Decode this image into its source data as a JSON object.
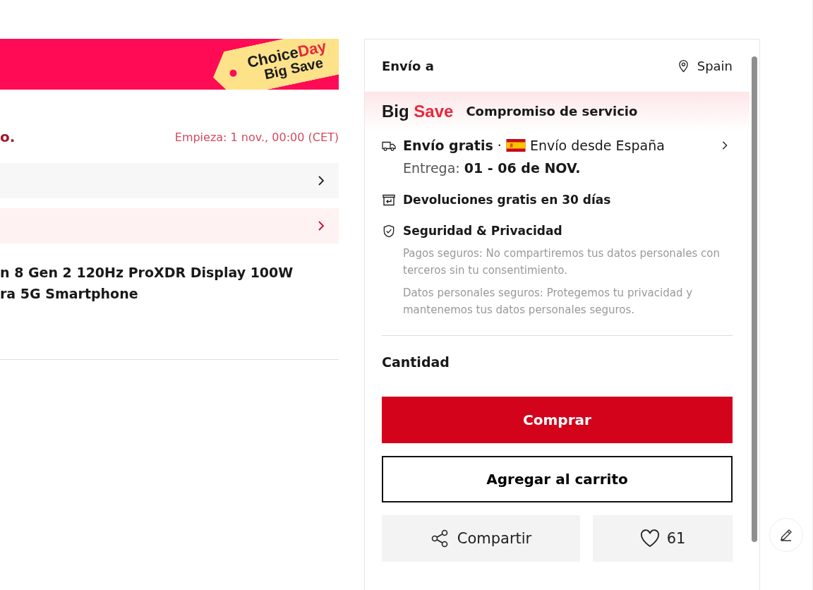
{
  "banner": {
    "tag": {
      "word1": "Choice",
      "word2": "Day",
      "line2": "Big Save"
    }
  },
  "promo": {
    "title_fragment": "o.",
    "start": "Empieza:  1 nov., 00:00 (CET)"
  },
  "option_rows": [
    {
      "kind": "plain"
    },
    {
      "kind": "highlight"
    }
  ],
  "product_title": [
    "n 8 Gen 2 120Hz ProXDR Display 100W",
    "ra 5G Smartphone"
  ],
  "panel": {
    "ship_to_label": "Envío a",
    "ship_to_country": "Spain",
    "service": {
      "brand1": "Big",
      "brand2": "Save",
      "title": "Compromiso de servicio"
    },
    "shipping": {
      "free": "Envío gratis",
      "separator": " · ",
      "origin": "Envío desde España",
      "delivery_label": "Entrega:",
      "delivery_dates": "01 - 06 de NOV."
    },
    "returns": "Devoluciones gratis en 30 días",
    "security": {
      "title": "Seguridad & Privacidad",
      "notes": [
        "Pagos seguros: No compartiremos tus datos personales con terceros sin tu consentimiento.",
        "Datos personales seguros: Protegemos tu privacidad y mantenemos tus datos personales seguros."
      ]
    },
    "quantity_label": "Cantidad",
    "buy": "Comprar",
    "add_to_cart": "Agregar al carrito",
    "share": "Compartir",
    "likes": "61"
  }
}
